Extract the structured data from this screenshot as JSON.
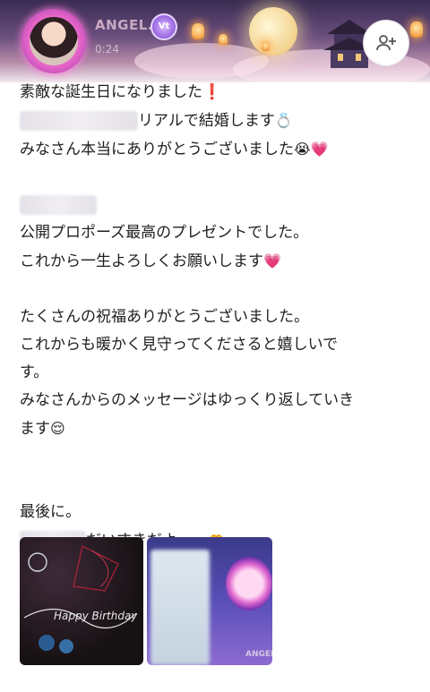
{
  "header": {
    "username": "ANGEL.",
    "level_badge": "Vt",
    "timestamp": "0:24",
    "follow_icon": "person-add-icon"
  },
  "post": {
    "lines": [
      "素敵な誕生日になりました",
      "リアルで結婚します",
      "みなさん本当にありがとうございました",
      "",
      "",
      "公開プロポーズ最高のプレゼントでした。",
      "これから一生よろしくお願いします",
      "",
      "たくさんの祝福ありがとうございました。",
      "これからも暖かく見守ってくださると嬉しいで",
      "す。",
      "みなさんからのメッセージはゆっくり返していき",
      "ます",
      "",
      "",
      "最後に。",
      "だいすきだよ ~~"
    ],
    "emojis": {
      "exclamation": "❗",
      "ring": "💍",
      "crying": "😭",
      "heart": "💗",
      "relieved": "😌",
      "heart_hands": "🫶"
    }
  },
  "images": {
    "left_caption": "Happy Birthday",
    "right_tag": "ANGEL"
  },
  "colors": {
    "banner_top": "#3a2c52",
    "banner_glow": "#e866c8",
    "heart": "#e94fb0",
    "username": "#c8a9c2"
  }
}
